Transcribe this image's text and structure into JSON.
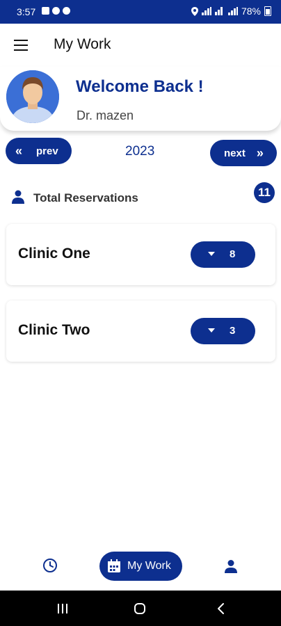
{
  "status_bar": {
    "time": "3:57",
    "battery": "78%"
  },
  "app_bar": {
    "title": "My Work"
  },
  "welcome": {
    "greeting": "Welcome Back !",
    "doctor_name": "Dr. mazen"
  },
  "year_nav": {
    "prev_label": "prev",
    "year": "2023",
    "next_label": "next"
  },
  "summary": {
    "label": "Total Reservations",
    "total": "11"
  },
  "clinics": [
    {
      "name": "Clinic One",
      "count": "8"
    },
    {
      "name": "Clinic Two",
      "count": "3"
    }
  ],
  "bottom_nav": {
    "active_label": "My Work"
  },
  "colors": {
    "primary": "#0d2f8f",
    "background": "#ffffff"
  }
}
